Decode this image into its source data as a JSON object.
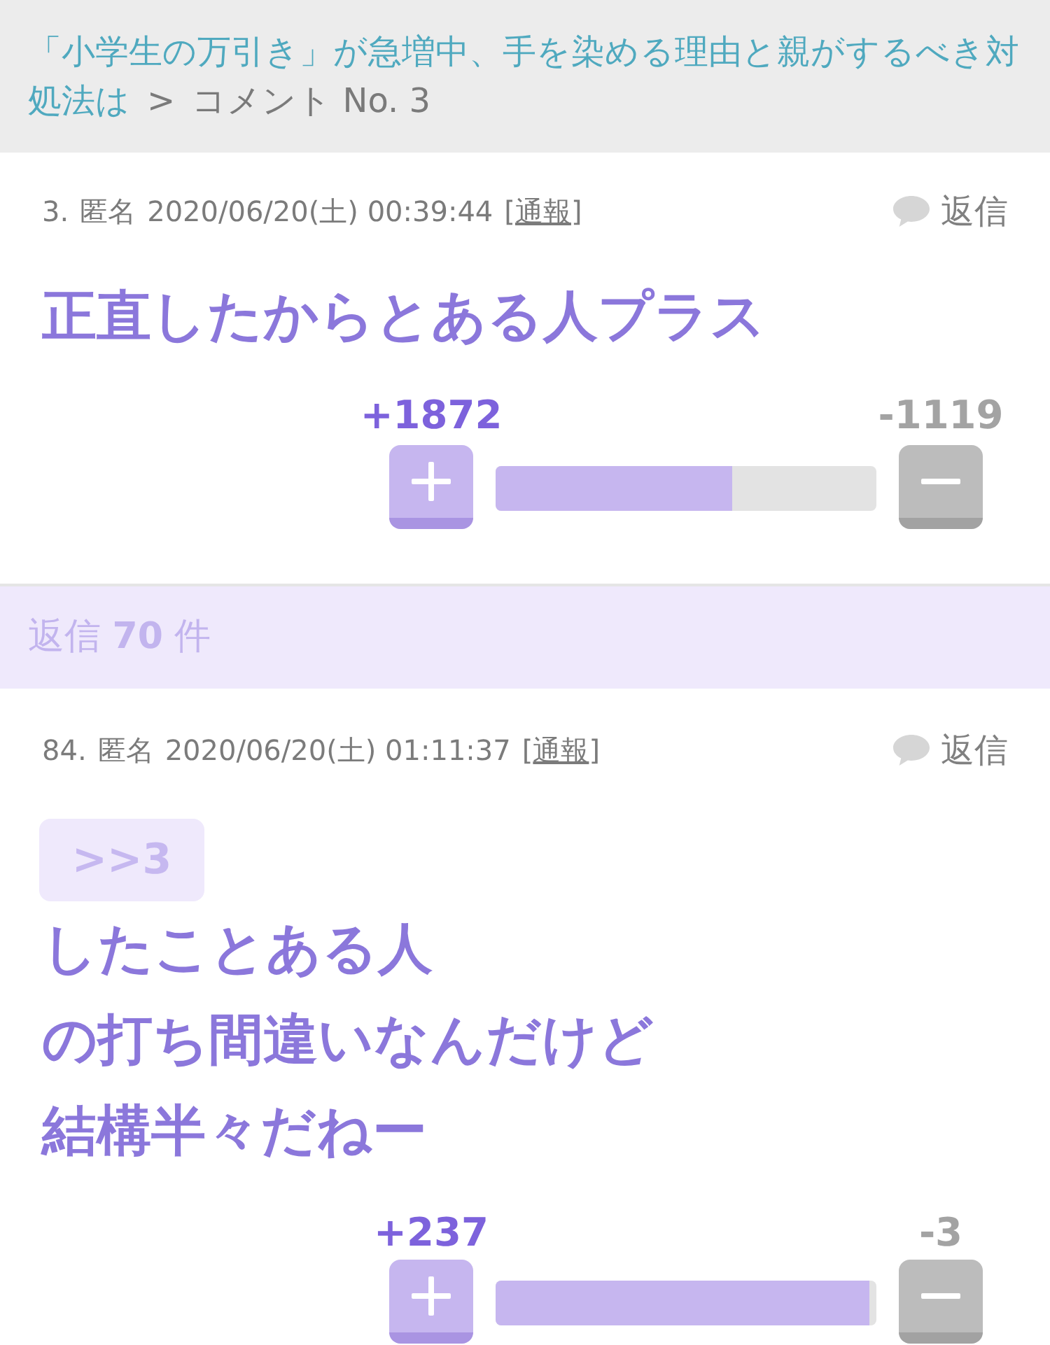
{
  "breadcrumb": {
    "link": "「小学生の万引き」が急増中、手を染める理由と親がするべき対処法は",
    "separator": ">",
    "current": "コメント No. 3"
  },
  "parent_comment": {
    "number": "3.",
    "author": "匿名",
    "date": "2020/06/20(土) 00:39:44",
    "report": {
      "open": "[",
      "label": "通報",
      "close": "]"
    },
    "reply": "返信",
    "body_lines": [
      "正直したからとある人プラス"
    ],
    "votes": {
      "plus": "+1872",
      "minus": "-1119",
      "level": 0.62
    }
  },
  "replies_bar": {
    "text": "返信 **70** 件"
  },
  "replies": [
    {
      "number": "84.",
      "author": "匿名",
      "date": "2020/06/20(土) 01:11:37",
      "report": {
        "open": "[",
        "label": "通報",
        "close": "]"
      },
      "reply": "返信",
      "anchor": ">>3",
      "body_lines": [
        "したことある人",
        "の打ち間違いなんだけど",
        "結構半々だねー"
      ],
      "votes": {
        "plus": "+237",
        "minus": "-3",
        "level": 0.98
      }
    }
  ]
}
